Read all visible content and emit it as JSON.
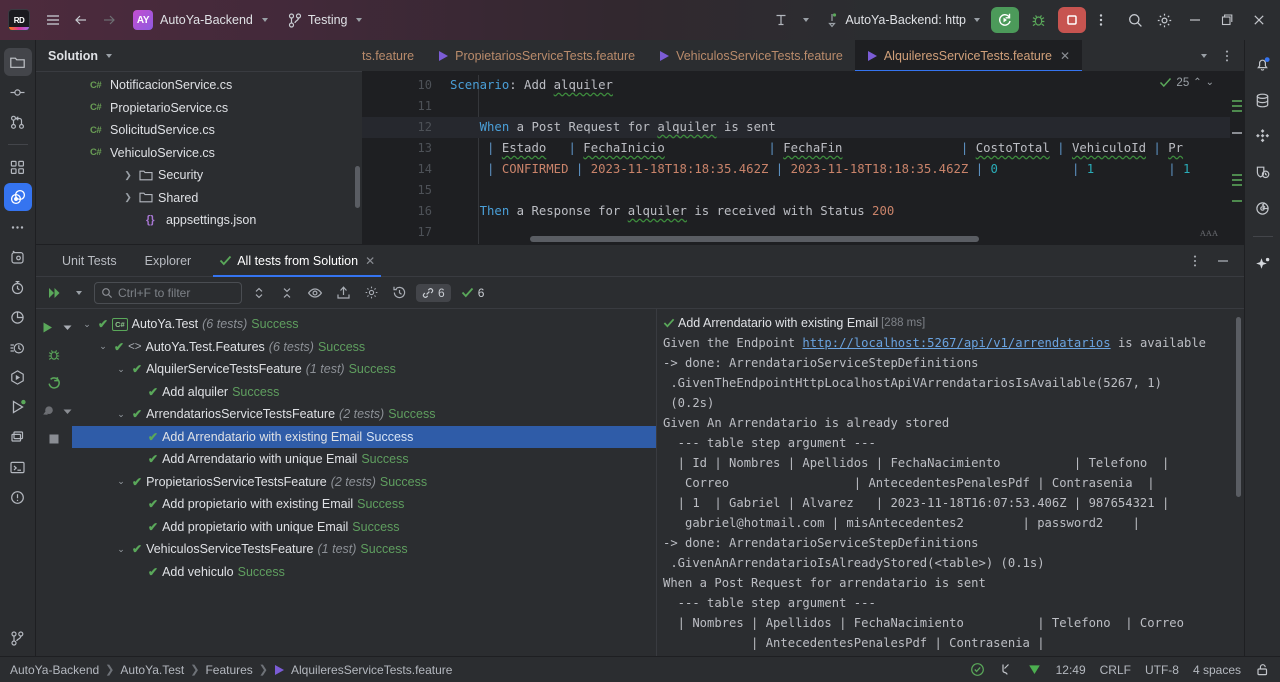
{
  "titlebar": {
    "logo_text": "RD",
    "hamburger": "menu-icon",
    "back": "back-arrow",
    "forward": "forward-arrow",
    "project_badge": "AY",
    "project_name": "AutoYa-Backend",
    "branch_name": "Testing",
    "run_config": "AutoYa-Backend: http",
    "run_label": "run-button",
    "debug_label": "debug-button",
    "stop_label": "stop-button",
    "more_label": "more-actions",
    "search_label": "search-everywhere",
    "settings_label": "settings",
    "minimize": "minimize",
    "maximize": "maximize",
    "close": "close"
  },
  "solution": {
    "title": "Solution",
    "items": [
      {
        "label": "NotificacionService.cs",
        "kind": "cs",
        "indent": 3,
        "expandable": false
      },
      {
        "label": "PropietarioService.cs",
        "kind": "cs",
        "indent": 3,
        "expandable": false
      },
      {
        "label": "SolicitudService.cs",
        "kind": "cs",
        "indent": 3,
        "expandable": false
      },
      {
        "label": "VehiculoService.cs",
        "kind": "cs",
        "indent": 3,
        "expandable": false
      },
      {
        "label": "Security",
        "kind": "folder",
        "indent": 2,
        "expandable": true
      },
      {
        "label": "Shared",
        "kind": "folder",
        "indent": 2,
        "expandable": true
      },
      {
        "label": "appsettings.json",
        "kind": "json",
        "indent": 2,
        "expandable": false
      }
    ]
  },
  "editor": {
    "tabs": [
      {
        "label": "ts.feature",
        "active": false,
        "cut": true
      },
      {
        "label": "PropietariosServiceTests.feature",
        "active": false,
        "cut": false
      },
      {
        "label": "VehiculosServiceTests.feature",
        "active": false,
        "cut": false
      },
      {
        "label": "AlquileresServiceTests.feature",
        "active": true,
        "cut": false
      }
    ],
    "inspection_count": "25",
    "lines": [
      {
        "num": "10",
        "highlight": false
      },
      {
        "num": "11",
        "highlight": false
      },
      {
        "num": "12",
        "highlight": true
      },
      {
        "num": "13",
        "highlight": false
      },
      {
        "num": "14",
        "highlight": false
      },
      {
        "num": "15",
        "highlight": false
      },
      {
        "num": "16",
        "highlight": false
      },
      {
        "num": "17",
        "highlight": false
      }
    ],
    "code": {
      "l10_kw": "Scenario",
      "l10_rest": ": Add ",
      "l10_word": "alquiler",
      "l12_kw": "When",
      "l12_a": " a Post Request for ",
      "l12_word": "alquiler",
      "l12_b": " is sent",
      "l13_cells": [
        "Estado",
        "FechaInicio",
        "FechaFin",
        "CostoTotal",
        "VehiculoId",
        "Pr"
      ],
      "l14_cells": [
        "CONFIRMED",
        "2023-11-18T18:18:35.462Z",
        "2023-11-18T18:18:35.462Z",
        "0",
        "1",
        "1"
      ],
      "l16_kw": "Then",
      "l16_a": " a Response for ",
      "l16_word": "alquiler",
      "l16_b": " is received with Status ",
      "l16_num": "200"
    }
  },
  "unit_tests": {
    "tabs": [
      {
        "label": "Unit Tests",
        "active": false,
        "tick": false,
        "closable": false
      },
      {
        "label": "Explorer",
        "active": false,
        "tick": false,
        "closable": false
      },
      {
        "label": "All tests from Solution",
        "active": true,
        "tick": true,
        "closable": true
      }
    ],
    "toolbar": {
      "rerun_label": "rerun-tests",
      "filter_placeholder": "Ctrl+F to filter",
      "expand_label": "expand-collapse",
      "collapse_label": "collapse-all",
      "show_label": "show-passed",
      "export_label": "export-results",
      "settings_label": "test-settings",
      "history_label": "test-history",
      "duration_count": "6",
      "passed_count": "6"
    },
    "run_rail": {
      "run": "run-icon",
      "debug": "debug-icon",
      "rerun": "rerun-icon",
      "coverage": "coverage-icon",
      "stop": "stop-icon"
    },
    "tree": [
      {
        "label": "AutoYa.Test",
        "count": "(6 tests)",
        "status": "Success",
        "indent": 0,
        "arrow": true,
        "icon": "cs",
        "selected": false
      },
      {
        "label": "AutoYa.Test.Features",
        "count": "(6 tests)",
        "status": "Success",
        "indent": 1,
        "arrow": true,
        "icon": "ns",
        "selected": false
      },
      {
        "label": "AlquilerServiceTestsFeature",
        "count": "(1 test)",
        "status": "Success",
        "indent": 2,
        "arrow": true,
        "icon": "none",
        "selected": false
      },
      {
        "label": "Add alquiler",
        "count": "",
        "status": "Success",
        "indent": 3,
        "arrow": false,
        "icon": "none",
        "selected": false
      },
      {
        "label": "ArrendatariosServiceTestsFeature",
        "count": "(2 tests)",
        "status": "Success",
        "indent": 2,
        "arrow": true,
        "icon": "none",
        "selected": false
      },
      {
        "label": "Add Arrendatario with existing Email",
        "count": "",
        "status": "Success",
        "indent": 3,
        "arrow": false,
        "icon": "none",
        "selected": true
      },
      {
        "label": "Add Arrendatario with unique Email",
        "count": "",
        "status": "Success",
        "indent": 3,
        "arrow": false,
        "icon": "none",
        "selected": false
      },
      {
        "label": "PropietariosServiceTestsFeature",
        "count": "(2 tests)",
        "status": "Success",
        "indent": 2,
        "arrow": true,
        "icon": "none",
        "selected": false
      },
      {
        "label": "Add propietario with existing Email",
        "count": "",
        "status": "Success",
        "indent": 3,
        "arrow": false,
        "icon": "none",
        "selected": false
      },
      {
        "label": "Add propietario with unique Email",
        "count": "",
        "status": "Success",
        "indent": 3,
        "arrow": false,
        "icon": "none",
        "selected": false
      },
      {
        "label": "VehiculosServiceTestsFeature",
        "count": "(1 test)",
        "status": "Success",
        "indent": 2,
        "arrow": true,
        "icon": "none",
        "selected": false
      },
      {
        "label": "Add vehiculo",
        "count": "",
        "status": "Success",
        "indent": 3,
        "arrow": false,
        "icon": "none",
        "selected": false
      }
    ],
    "output": {
      "header_title": "Add Arrendatario with existing Email",
      "header_duration": "[288 ms]",
      "line1_a": "Given the Endpoint ",
      "line1_link": "http://localhost:5267/api/v1/arrendatarios",
      "line1_b": " is available",
      "lines": [
        "-> done: ArrendatarioServiceStepDefinitions",
        " .GivenTheEndpointHttpLocalhostApiVArrendatariosIsAvailable(5267, 1)",
        " (0.2s)",
        "Given An Arrendatario is already stored",
        "  --- table step argument ---",
        "  | Id | Nombres | Apellidos | FechaNacimiento          | Telefono  |",
        "   Correo                 | AntecedentesPenalesPdf | Contrasenia  |",
        "  | 1  | Gabriel | Alvarez   | 2023-11-18T16:07:53.406Z | 987654321 |",
        "   gabriel@hotmail.com | misAntecedentes2        | password2    |",
        "-> done: ArrendatarioServiceStepDefinitions",
        " .GivenAnArrendatarioIsAlreadyStored(<table>) (0.1s)",
        "When a Post Request for arrendatario is sent",
        "  --- table step argument ---",
        "  | Nombres | Apellidos | FechaNacimiento          | Telefono  | Correo",
        "            | AntecedentesPenalesPdf | Contrasenia |"
      ]
    }
  },
  "status_bar": {
    "breadcrumb": [
      "AutoYa-Backend",
      "AutoYa.Test",
      "Features",
      "AlquileresServiceTests.feature"
    ],
    "time": "12:49",
    "line_sep": "CRLF",
    "encoding": "UTF-8",
    "indent": "4 spaces",
    "lock": "read-only-toggle",
    "check": "inspections-ok",
    "branch_icon": "branch-icon",
    "download_icon": "download-icon"
  },
  "colors": {
    "accent": "#3574f0",
    "success": "#5aa85a",
    "selection": "#2f5ca8",
    "danger": "#c75450"
  }
}
